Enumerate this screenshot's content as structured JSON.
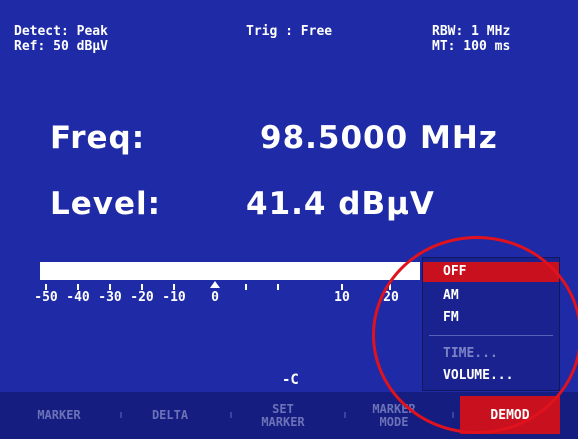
{
  "header": {
    "detect": "Detect: Peak",
    "ref": "Ref: 50 dBµV",
    "trig": "Trig  : Free",
    "rbw": "RBW: 1 MHz",
    "mt": "MT: 100 ms"
  },
  "readout": {
    "freq_label": "Freq:",
    "freq_value": "98.5000 MHz",
    "level_label": "Level:",
    "level_value": "41.4 dBµV"
  },
  "level_bar": {
    "fill_fraction": 1.0,
    "scale_labels": [
      "-50",
      "-40",
      "-30",
      "-20",
      "-10",
      "0",
      "10",
      "20"
    ]
  },
  "demod_menu": {
    "items": [
      {
        "label": "OFF",
        "selected": true,
        "enabled": true
      },
      {
        "label": "AM",
        "selected": false,
        "enabled": true
      },
      {
        "label": "FM",
        "selected": false,
        "enabled": true
      },
      {
        "label": "TIME...",
        "selected": false,
        "enabled": false
      },
      {
        "label": "VOLUME...",
        "selected": false,
        "enabled": true
      }
    ]
  },
  "softkeys": {
    "marker": "MARKER",
    "delta": "DELTA",
    "set_marker_1": "SET",
    "set_marker_2": "MARKER",
    "marker_mode_1": "MARKER",
    "marker_mode_2": "MODE",
    "demod": "DEMOD"
  },
  "icons": {
    "power_plug": "plug-icon"
  },
  "colors": {
    "screen_bg": "#1f2aa6",
    "softkey_bg": "#151d80",
    "active_red": "#c8101e",
    "annotation_circle": "#e0121e"
  }
}
